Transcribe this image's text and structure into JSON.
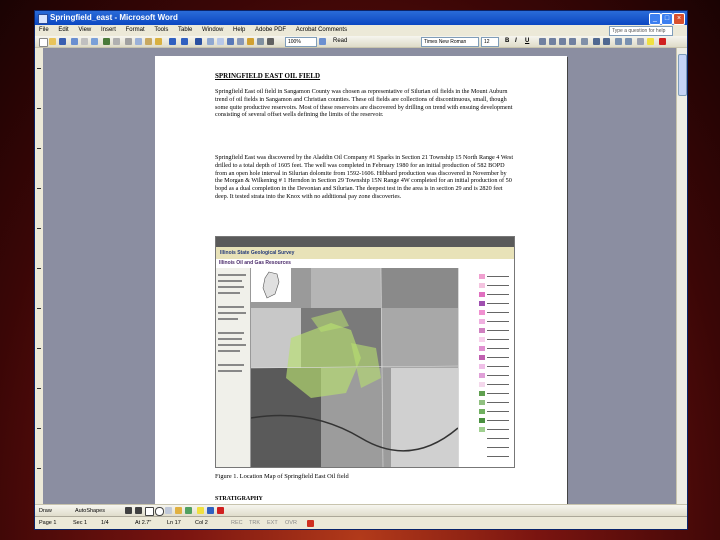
{
  "window": {
    "title": "Springfield_east - Microsoft Word",
    "controls": [
      "_",
      "□",
      "×"
    ]
  },
  "menu": {
    "items": [
      "File",
      "Edit",
      "View",
      "Insert",
      "Format",
      "Tools",
      "Table",
      "Window",
      "Help",
      "Adobe PDF",
      "Acrobat Comments"
    ],
    "help_placeholder": "Type a question for help"
  },
  "toolbar": {
    "zoom": "100%",
    "read_label": "Read",
    "font_name": "Times New Roman",
    "font_size": "12",
    "bold": "B",
    "italic": "I",
    "underline": "U"
  },
  "document": {
    "heading": "SPRINGFIELD EAST OIL FIELD",
    "paragraph1": "Springfield East oil field in Sangamon County was chosen as representative of Silurian oil fields in the Mount Auburn trend of oil fields in Sangamon and Christian counties. These oil fields are collections of discontinuous, small, though some quite productive reservoirs. Most of these reservoirs are discovered by drilling on trend with ensuing development consisting of several offset wells defining the limits of the reservoir.",
    "paragraph2": "Springfield East was discovered by the Aladdin Oil Company #1 Sparks in Section 21 Township 15 North Range 4 West drilled to a total depth of 1605 feet. The well was completed in February 1980 for an initial production of 582 BOPD from an open hole interval in Silurian dolomite from 1592-1606. Hibbard production was discovered in November by the Morgan & Wilkening # 1 Herndon in Section 29 Township 15N Range 4W completed for an initial production of 50 bopd as a dual completion in the Devonian and Silurian. The deepest test in the area is in section 29 and is 2820 feet deep. It tested strata into the Knox with no additional pay zone discoveries.",
    "figure_caption": "Figure 1. Location Map of Springfield East Oil field",
    "next_section": "STRATIGRAPHY"
  },
  "map_screenshot": {
    "banner": "Illinois State Geological Survey",
    "title": "Illinois Oil and Gas Resources"
  },
  "bottom_toolbar": {
    "draw_label": "Draw",
    "autoshapes_label": "AutoShapes"
  },
  "status": {
    "page": "Page 1",
    "section": "Sec 1",
    "page_of": "1/4",
    "at": "At 2.7\"",
    "line": "Ln 17",
    "col": "Col 2",
    "rec": "REC",
    "trk": "TRK",
    "ext": "EXT",
    "ovr": "OVR"
  },
  "colors": {
    "frame": "#6b0f0f",
    "title_bar": "#0b47c2",
    "doc_background": "#8b8ea1",
    "page": "#ffffff"
  }
}
